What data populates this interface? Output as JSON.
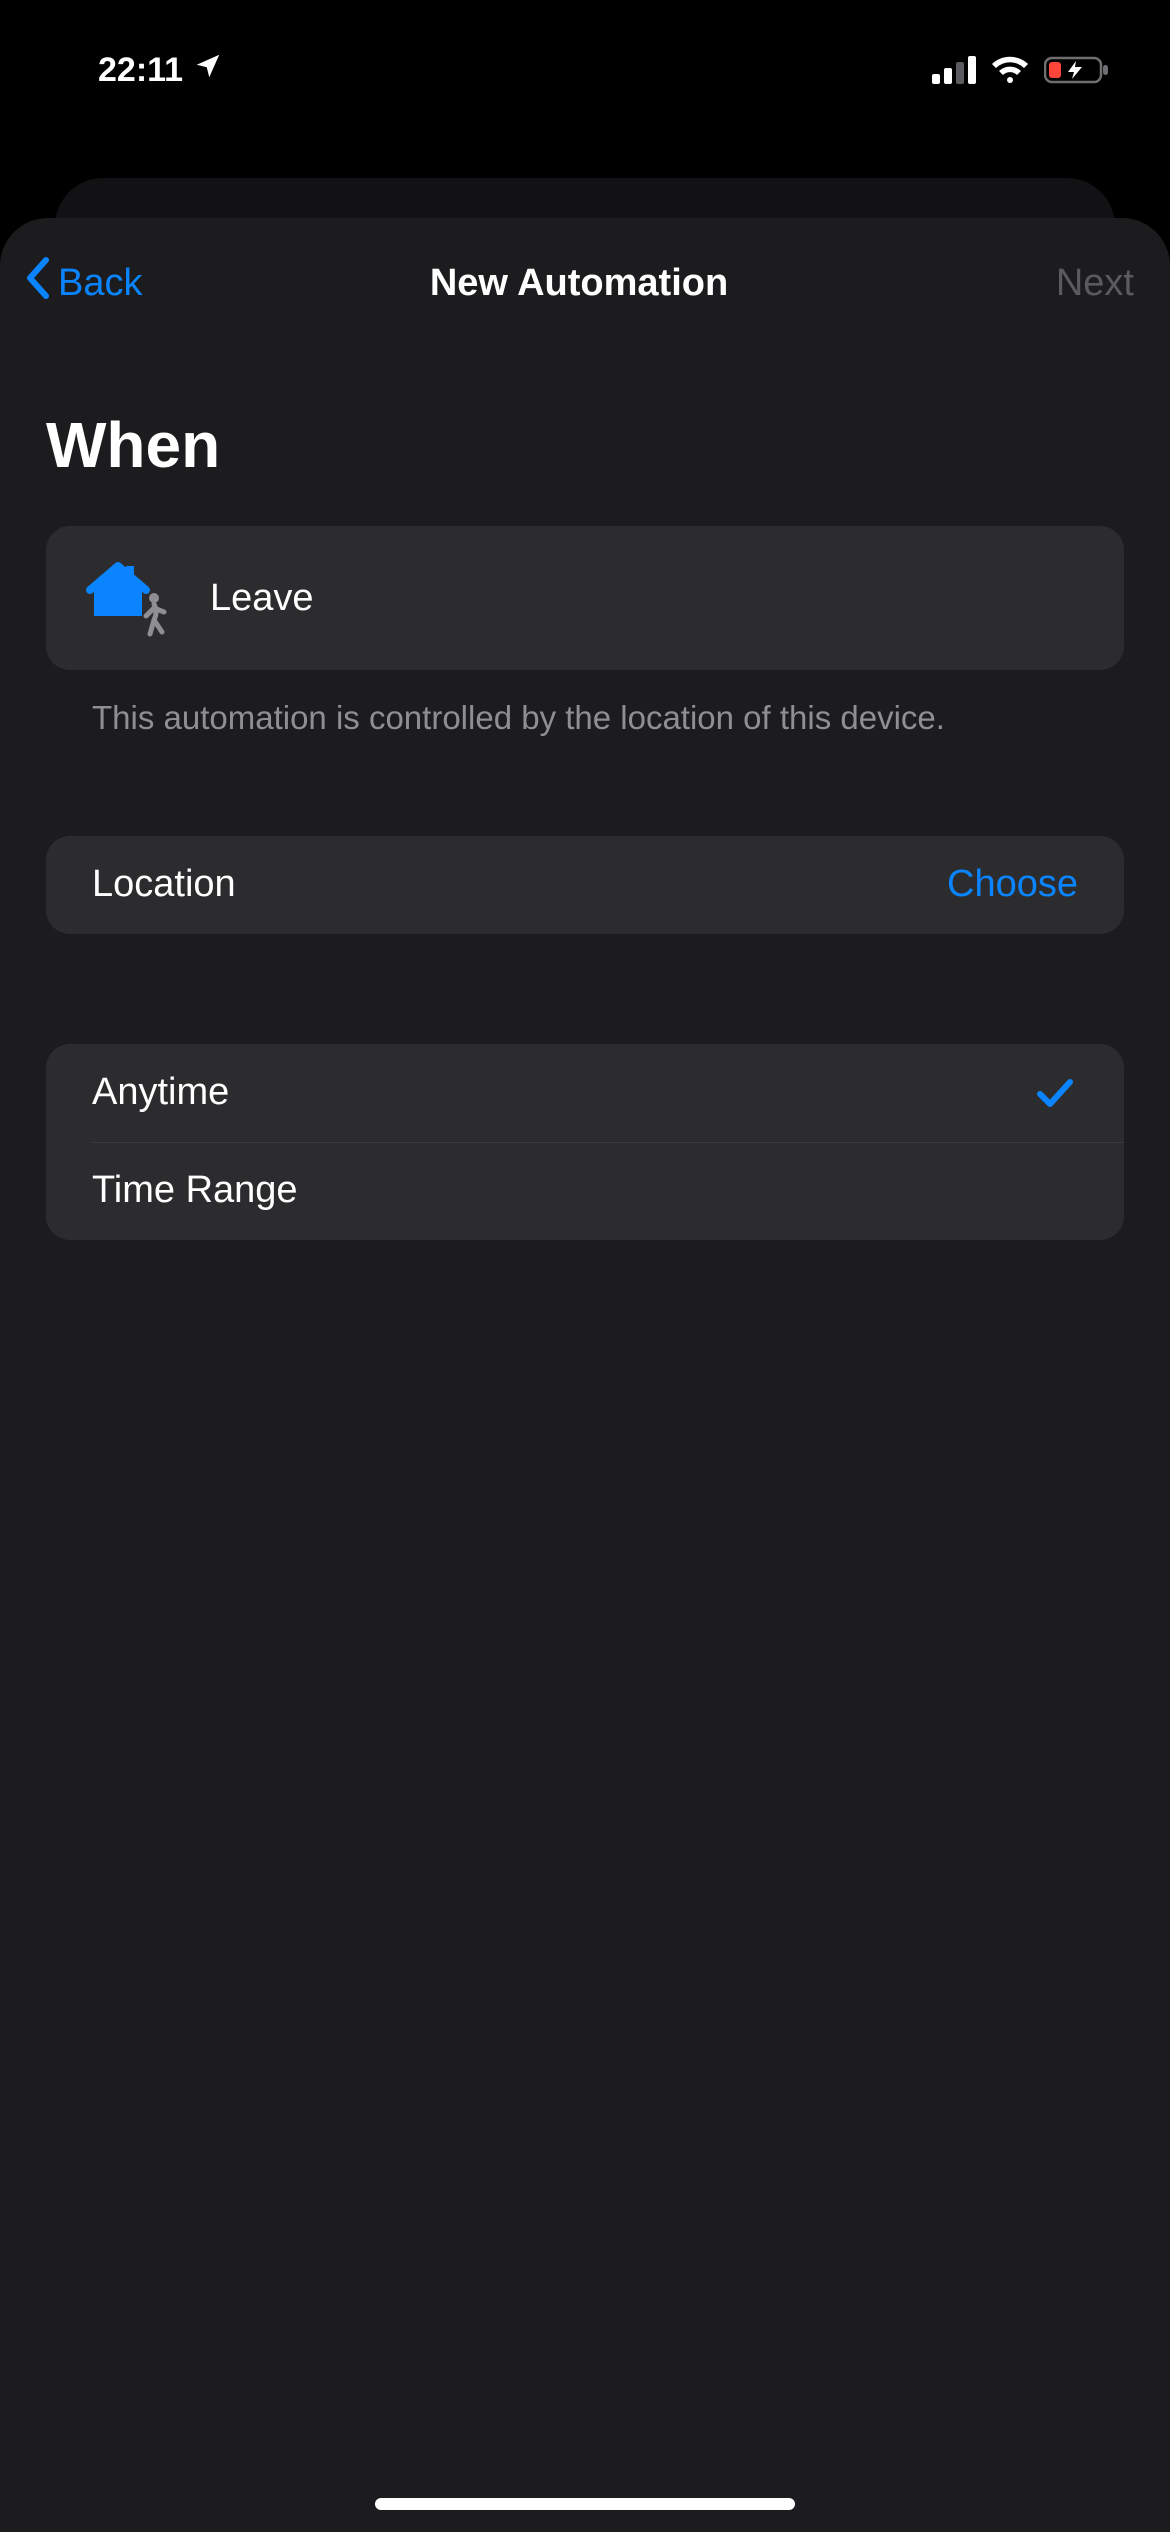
{
  "status": {
    "time": "22:11"
  },
  "nav": {
    "back": "Back",
    "title": "New Automation",
    "next": "Next"
  },
  "section_title": "When",
  "leave": {
    "label": "Leave",
    "footnote": "This automation is controlled by the location of this device."
  },
  "location": {
    "label": "Location",
    "action": "Choose"
  },
  "time_options": [
    {
      "label": "Anytime",
      "selected": true
    },
    {
      "label": "Time Range",
      "selected": false
    }
  ],
  "colors": {
    "accent": "#0a84ff"
  }
}
